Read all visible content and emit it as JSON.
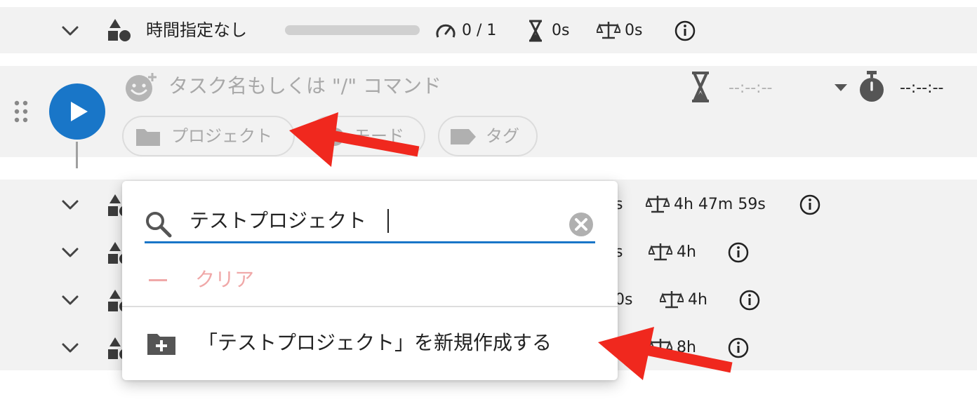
{
  "summary": {
    "title": "時間指定なし",
    "progress_label": "0 / 1",
    "estimate_label": "0s",
    "balance_label": "0s",
    "progress_fraction": 0
  },
  "composer": {
    "task_placeholder": "タスク名もしくは \"/\" コマンド",
    "estimate_value": "--:--:--",
    "timer_value": "--:--:--",
    "chips": {
      "project": "プロジェクト",
      "mode": "モード",
      "tag": "タグ"
    }
  },
  "rows": [
    {
      "estimate_tail": "s",
      "balance": "4h 47m 59s"
    },
    {
      "estimate_tail": "s",
      "balance": "4h"
    },
    {
      "estimate_tail": "0s",
      "balance": "4h"
    },
    {
      "estimate_tail": "",
      "balance": "8h"
    }
  ],
  "popup": {
    "search_value": "テストプロジェクト",
    "clear_label": "クリア",
    "create_label": "「テストプロジェクト」を新規作成する"
  },
  "colors": {
    "play_button": "#1976c8",
    "search_underline": "#1976c8",
    "clear_text": "#f0a8a8",
    "arrow": "#f0281e"
  }
}
